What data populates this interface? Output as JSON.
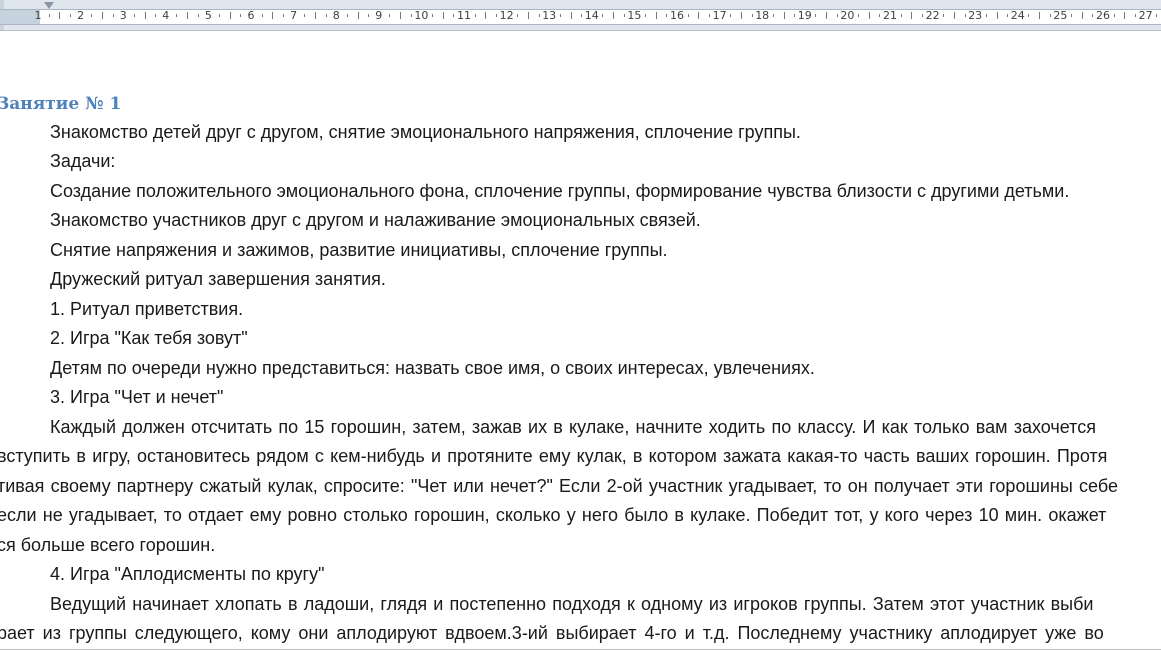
{
  "ruler": {
    "numbers": [
      "1",
      "2",
      "3",
      "4",
      "5",
      "6",
      "7",
      "8",
      "9",
      "10",
      "11",
      "12",
      "13",
      "14",
      "15",
      "16",
      "17",
      "18",
      "19",
      "20",
      "21",
      "22",
      "23",
      "24",
      "25",
      "26",
      "27"
    ]
  },
  "document": {
    "heading": "Занятие № 1",
    "lines": [
      "Знакомство детей друг с другом, снятие эмоционального напряжения, сплочение группы.",
      "Задачи:",
      "Создание положительного эмоционального фона, сплочение группы, формирование чувства близости с другими детьми.",
      "Знакомство участников друг с другом и налаживание эмоциональных связей.",
      "Снятие напряжения и зажимов, развитие инициативы, сплочение группы.",
      "Дружеский ритуал завершения занятия.",
      "1. Ритуал приветствия.",
      "2. Игра \"Как тебя зовут\"",
      "Детям по очереди нужно представиться: назвать свое имя, о своих интересах, увлечениях.",
      "3. Игра \"Чет и нечет\"",
      "Каждый должен отсчитать по 15 горошин, затем, зажав их в кулаке, начните ходить по классу. И как только вам захочется",
      "вступить в игру, остановитесь рядом с кем-нибудь и протяните ему кулак, в котором зажата какая-то часть ваших горошин. Протя",
      "тивая своему партнеру сжатый кулак, спросите: \"Чет или нечет?\" Если 2-ой участник угадывает, то он получает эти горошины себе",
      "если не угадывает, то отдает ему ровно столько горошин, сколько у него было в кулаке. Победит тот, у кого через 10 мин. окажет",
      "ся больше всего горошин.",
      "4. Игра \"Аплодисменты по кругу\"",
      "Ведущий начинает хлопать в ладоши, глядя и постепенно подходя к одному из игроков группы. Затем этот участник выби",
      "рает из группы следующего, кому они аплодируют вдвоем.3-ий выбирает 4-го и т.д. Последнему участнику аплодирует уже во"
    ]
  }
}
